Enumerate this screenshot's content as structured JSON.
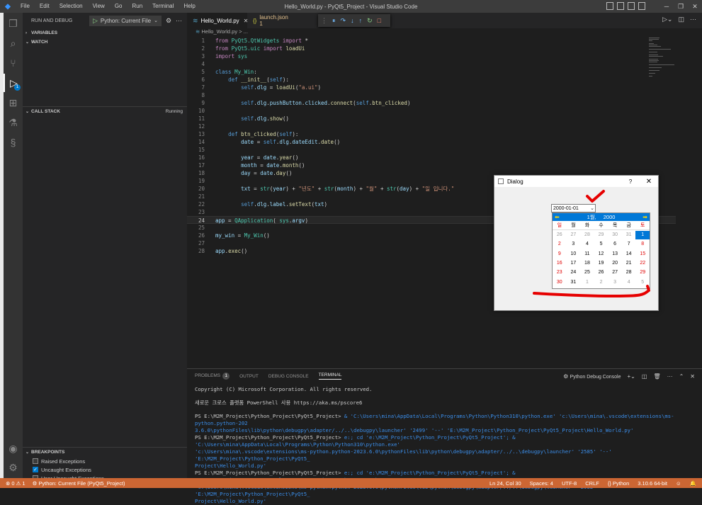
{
  "titlebar": {
    "window_title": "Hello_World.py - PyQt5_Project - Visual Studio Code",
    "menu": [
      "File",
      "Edit",
      "Selection",
      "View",
      "Go",
      "Run",
      "Terminal",
      "Help"
    ],
    "logo": "vscode-logo"
  },
  "activity_bar": {
    "icons": [
      "explorer-icon",
      "search-icon",
      "source-control-icon",
      "run-debug-icon",
      "extensions-icon",
      "testing-icon",
      "python-icon",
      "account-icon",
      "manage-gear-icon"
    ],
    "debug_badge": "1"
  },
  "sidebar": {
    "run_label": "RUN AND DEBUG",
    "config": "Python: Current File",
    "sections": {
      "variables": "VARIABLES",
      "watch": "WATCH",
      "call_stack": "CALL STACK",
      "call_stack_state": "Running",
      "breakpoints": "BREAKPOINTS"
    },
    "breakpoints": [
      {
        "label": "Raised Exceptions",
        "checked": false
      },
      {
        "label": "Uncaught Exceptions",
        "checked": true
      },
      {
        "label": "User Uncaught Exceptions",
        "checked": false
      }
    ]
  },
  "tabs": [
    {
      "label": "Hello_World.py",
      "active": true
    },
    {
      "label": "launch.json 1",
      "active": false
    }
  ],
  "breadcrumb": {
    "file": "Hello_World.py",
    "rest": "> ..."
  },
  "code": {
    "current_line": 24,
    "lines": [
      {
        "n": "1",
        "tokens": [
          [
            "kw",
            "from "
          ],
          [
            "cls",
            "PyQt5.QtWidgets"
          ],
          [
            "kw",
            " import "
          ],
          [
            "txt",
            "*"
          ]
        ]
      },
      {
        "n": "2",
        "tokens": [
          [
            "kw",
            "from "
          ],
          [
            "cls",
            "PyQt5.uic"
          ],
          [
            "kw",
            " import "
          ],
          [
            "fn",
            "loadUi"
          ]
        ]
      },
      {
        "n": "3",
        "tokens": [
          [
            "kw",
            "import "
          ],
          [
            "cls",
            "sys"
          ]
        ]
      },
      {
        "n": "4",
        "tokens": []
      },
      {
        "n": "5",
        "tokens": [
          [
            "kw2",
            "class "
          ],
          [
            "cls",
            "My_Win"
          ],
          [
            "txt",
            ":"
          ]
        ]
      },
      {
        "n": "6",
        "tokens": [
          [
            "txt",
            "    "
          ],
          [
            "kw2",
            "def "
          ],
          [
            "fn",
            "__init__"
          ],
          [
            "txt",
            "("
          ],
          [
            "slf",
            "self"
          ],
          [
            "txt",
            "):"
          ]
        ]
      },
      {
        "n": "7",
        "tokens": [
          [
            "txt",
            "        "
          ],
          [
            "slf",
            "self"
          ],
          [
            "txt",
            "."
          ],
          [
            "var",
            "dlg"
          ],
          [
            "txt",
            " = "
          ],
          [
            "fn",
            "loadUi"
          ],
          [
            "txt",
            "("
          ],
          [
            "str",
            "\"a.ui\""
          ],
          [
            "txt",
            ")"
          ]
        ]
      },
      {
        "n": "8",
        "tokens": []
      },
      {
        "n": "9",
        "tokens": [
          [
            "txt",
            "        "
          ],
          [
            "slf",
            "self"
          ],
          [
            "txt",
            "."
          ],
          [
            "var",
            "dlg"
          ],
          [
            "txt",
            "."
          ],
          [
            "var",
            "pushButton"
          ],
          [
            "txt",
            "."
          ],
          [
            "var",
            "clicked"
          ],
          [
            "txt",
            "."
          ],
          [
            "fn",
            "connect"
          ],
          [
            "txt",
            "("
          ],
          [
            "slf",
            "self"
          ],
          [
            "txt",
            "."
          ],
          [
            "fn",
            "btn_clicked"
          ],
          [
            "txt",
            ")"
          ]
        ]
      },
      {
        "n": "10",
        "tokens": []
      },
      {
        "n": "11",
        "tokens": [
          [
            "txt",
            "        "
          ],
          [
            "slf",
            "self"
          ],
          [
            "txt",
            "."
          ],
          [
            "var",
            "dlg"
          ],
          [
            "txt",
            "."
          ],
          [
            "fn",
            "show"
          ],
          [
            "txt",
            "()"
          ]
        ]
      },
      {
        "n": "12",
        "tokens": []
      },
      {
        "n": "13",
        "tokens": [
          [
            "txt",
            "    "
          ],
          [
            "kw2",
            "def "
          ],
          [
            "fn",
            "btn_clicked"
          ],
          [
            "txt",
            "("
          ],
          [
            "slf",
            "self"
          ],
          [
            "txt",
            "):"
          ]
        ]
      },
      {
        "n": "14",
        "tokens": [
          [
            "txt",
            "        "
          ],
          [
            "var",
            "date"
          ],
          [
            "txt",
            " = "
          ],
          [
            "slf",
            "self"
          ],
          [
            "txt",
            "."
          ],
          [
            "var",
            "dlg"
          ],
          [
            "txt",
            "."
          ],
          [
            "var",
            "dateEdit"
          ],
          [
            "txt",
            "."
          ],
          [
            "fn",
            "date"
          ],
          [
            "txt",
            "()"
          ]
        ]
      },
      {
        "n": "15",
        "tokens": []
      },
      {
        "n": "16",
        "tokens": [
          [
            "txt",
            "        "
          ],
          [
            "var",
            "year"
          ],
          [
            "txt",
            " = "
          ],
          [
            "var",
            "date"
          ],
          [
            "txt",
            "."
          ],
          [
            "fn",
            "year"
          ],
          [
            "txt",
            "()"
          ]
        ]
      },
      {
        "n": "17",
        "tokens": [
          [
            "txt",
            "        "
          ],
          [
            "var",
            "month"
          ],
          [
            "txt",
            " = "
          ],
          [
            "var",
            "date"
          ],
          [
            "txt",
            "."
          ],
          [
            "fn",
            "month"
          ],
          [
            "txt",
            "()"
          ]
        ]
      },
      {
        "n": "18",
        "tokens": [
          [
            "txt",
            "        "
          ],
          [
            "var",
            "day"
          ],
          [
            "txt",
            " = "
          ],
          [
            "var",
            "date"
          ],
          [
            "txt",
            "."
          ],
          [
            "fn",
            "day"
          ],
          [
            "txt",
            "()"
          ]
        ]
      },
      {
        "n": "19",
        "tokens": []
      },
      {
        "n": "20",
        "tokens": [
          [
            "txt",
            "        "
          ],
          [
            "var",
            "txt"
          ],
          [
            "txt",
            " = "
          ],
          [
            "cls",
            "str"
          ],
          [
            "txt",
            "("
          ],
          [
            "var",
            "year"
          ],
          [
            "txt",
            ") + "
          ],
          [
            "str",
            "\"년도\""
          ],
          [
            "txt",
            " + "
          ],
          [
            "cls",
            "str"
          ],
          [
            "txt",
            "("
          ],
          [
            "var",
            "month"
          ],
          [
            "txt",
            ") + "
          ],
          [
            "str",
            "\"월\""
          ],
          [
            "txt",
            " + "
          ],
          [
            "cls",
            "str"
          ],
          [
            "txt",
            "("
          ],
          [
            "var",
            "day"
          ],
          [
            "txt",
            ") + "
          ],
          [
            "str",
            "\"일 입니다.\""
          ]
        ]
      },
      {
        "n": "21",
        "tokens": []
      },
      {
        "n": "22",
        "tokens": [
          [
            "txt",
            "        "
          ],
          [
            "slf",
            "self"
          ],
          [
            "txt",
            "."
          ],
          [
            "var",
            "dlg"
          ],
          [
            "txt",
            "."
          ],
          [
            "var",
            "label"
          ],
          [
            "txt",
            "."
          ],
          [
            "fn",
            "setText"
          ],
          [
            "txt",
            "("
          ],
          [
            "var",
            "txt"
          ],
          [
            "txt",
            ")"
          ]
        ]
      },
      {
        "n": "23",
        "tokens": []
      },
      {
        "n": "24",
        "tokens": [
          [
            "var",
            "app"
          ],
          [
            "txt",
            " = "
          ],
          [
            "cls",
            "QApplication"
          ],
          [
            "txt",
            "( "
          ],
          [
            "cls",
            "sys"
          ],
          [
            "txt",
            "."
          ],
          [
            "var",
            "argv"
          ],
          [
            "txt",
            ")"
          ]
        ]
      },
      {
        "n": "25",
        "tokens": []
      },
      {
        "n": "26",
        "tokens": [
          [
            "var",
            "my_win"
          ],
          [
            "txt",
            " = "
          ],
          [
            "cls",
            "My_Win"
          ],
          [
            "txt",
            "()"
          ]
        ]
      },
      {
        "n": "27",
        "tokens": []
      },
      {
        "n": "28",
        "tokens": [
          [
            "var",
            "app"
          ],
          [
            "txt",
            "."
          ],
          [
            "fn",
            "exec"
          ],
          [
            "txt",
            "()"
          ]
        ]
      }
    ]
  },
  "panel": {
    "tabs": [
      {
        "label": "PROBLEMS",
        "count": "1"
      },
      {
        "label": "OUTPUT"
      },
      {
        "label": "DEBUG CONSOLE"
      },
      {
        "label": "TERMINAL",
        "active": true
      }
    ],
    "terminal_name": "Python Debug Console",
    "terminal_lines": [
      "Copyright (C) Microsoft Corporation. All rights reserved.",
      "",
      "새로운 크로스 플랫폼 PowerShell 사용 https://aka.ms/pscore6",
      "",
      "PS E:\\M2M_Project\\Python_Project\\PyQt5_Project>  & 'C:\\Users\\mina\\AppData\\Local\\Programs\\Python\\Python310\\python.exe' 'c:\\Users\\mina\\.vscode\\extensions\\ms-python.python-202",
      "3.6.0\\pythonFiles\\lib\\python\\debugpy\\adapter/../..\\debugpy\\launcher' '2499' '--' 'E:\\M2M_Project\\Python_Project\\PyQt5_Project\\Hello_World.py'",
      "PS E:\\M2M_Project\\Python_Project\\PyQt5_Project>  e:; cd 'e:\\M2M_Project\\Python_Project\\PyQt5_Project'; & 'C:\\Users\\mina\\AppData\\Local\\Programs\\Python\\Python310\\python.exe'",
      " 'c:\\Users\\mina\\.vscode\\extensions\\ms-python.python-2023.6.0\\pythonFiles\\lib\\python\\debugpy\\adapter/../..\\debugpy\\launcher' '2585' '--' 'E:\\M2M_Project\\Python_Project\\PyQt5_",
      "Project\\Hello_World.py'",
      "PS E:\\M2M_Project\\Python_Project\\PyQt5_Project>  e:; cd 'e:\\M2M_Project\\Python_Project\\PyQt5_Project'; & 'C:\\Users\\mina\\AppData\\Local\\Programs\\Python\\Python310\\python.exe'",
      " 'c:\\Users\\mina\\.vscode\\extensions\\ms-python.python-2023.6.0\\pythonFiles\\lib\\python\\debugpy\\adapter/../..\\debugpy\\launcher' '2932' '--' 'E:\\M2M_Project\\Python_Project\\PyQt5_",
      "Project\\Hello_World.py'"
    ]
  },
  "statusbar": {
    "errors": "⊗ 0 ⚠ 1",
    "debug_config": "Python: Current File (PyQt5_Project)",
    "position": "Ln 24, Col 30",
    "spaces": "Spaces: 4",
    "encoding": "UTF-8",
    "eol": "CRLF",
    "language": "Python",
    "interpreter": "3.10.6 64-bit"
  },
  "dialog": {
    "title": "Dialog",
    "help": "?",
    "close": "✕",
    "date_value": "2000-01-01",
    "calendar": {
      "month_label": "1월,",
      "year_label": "2000",
      "weekdays": [
        "일",
        "월",
        "화",
        "수",
        "목",
        "금",
        "토"
      ],
      "weeks": [
        [
          "26",
          "27",
          "28",
          "29",
          "30",
          "31",
          "1"
        ],
        [
          "2",
          "3",
          "4",
          "5",
          "6",
          "7",
          "8"
        ],
        [
          "9",
          "10",
          "11",
          "12",
          "13",
          "14",
          "15"
        ],
        [
          "16",
          "17",
          "18",
          "19",
          "20",
          "21",
          "22"
        ],
        [
          "23",
          "24",
          "25",
          "26",
          "27",
          "28",
          "29"
        ],
        [
          "30",
          "31",
          "1",
          "2",
          "3",
          "4",
          "5"
        ]
      ],
      "selected": "1"
    }
  },
  "colors": {
    "statusbar": "#cc6633",
    "accent": "#007acc",
    "annotation": "#e60000"
  }
}
